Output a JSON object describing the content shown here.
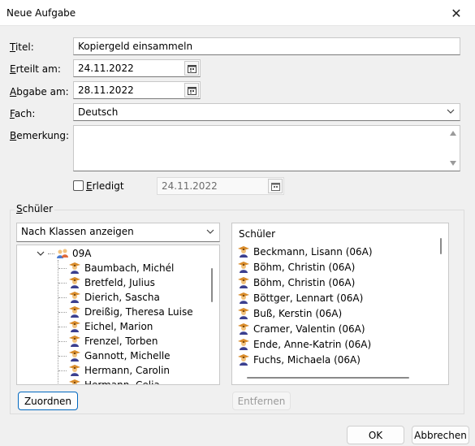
{
  "window": {
    "title": "Neue Aufgabe",
    "close_glyph": "✕"
  },
  "form": {
    "titel_label": "Titel:",
    "titel_value": "Kopiergeld einsammeln",
    "erteilt_label": "Erteilt am:",
    "erteilt_value": "24.11.2022",
    "abgabe_label": "Abgabe am:",
    "abgabe_value": "28.11.2022",
    "fach_label": "Fach:",
    "fach_value": "Deutsch",
    "bemerkung_label": "Bemerkung:",
    "bemerkung_value": "",
    "erledigt_label": "Erledigt",
    "erledigt_checked": false,
    "erledigt_date": "24.11.2022"
  },
  "schueler_group": {
    "title": "Schüler",
    "view_select": "Nach Klassen anzeigen",
    "tree": {
      "class_label": "09A",
      "students": [
        "Baumbach, Michél",
        "Bretfeld, Julius",
        "Dierich, Sascha",
        "Dreißig, Theresa Luise",
        "Eichel, Marion",
        "Frenzel, Torben",
        "Gannott, Michelle",
        "Hermann, Carolin",
        "Hermann, Celia"
      ]
    },
    "list": {
      "header": "Schüler",
      "items": [
        "Beckmann, Lisann (06A)",
        "Böhm, Christin (06A)",
        "Böhm, Christin (06A)",
        "Böttger, Lennart (06A)",
        "Buß, Kerstin (06A)",
        "Cramer, Valentin (06A)",
        "Ende, Anne-Katrin (06A)",
        "Fuchs, Michaela (06A)"
      ]
    },
    "assign_button": "Zuordnen",
    "remove_button": "Entfernen"
  },
  "footer": {
    "ok_button": "OK",
    "cancel_button": "Abbrechen"
  },
  "colors": {
    "accent": "#0067c0",
    "icon_gown": "#3b3f8f",
    "icon_face": "#f1c27d",
    "icon_cap": "#d98c2b"
  }
}
